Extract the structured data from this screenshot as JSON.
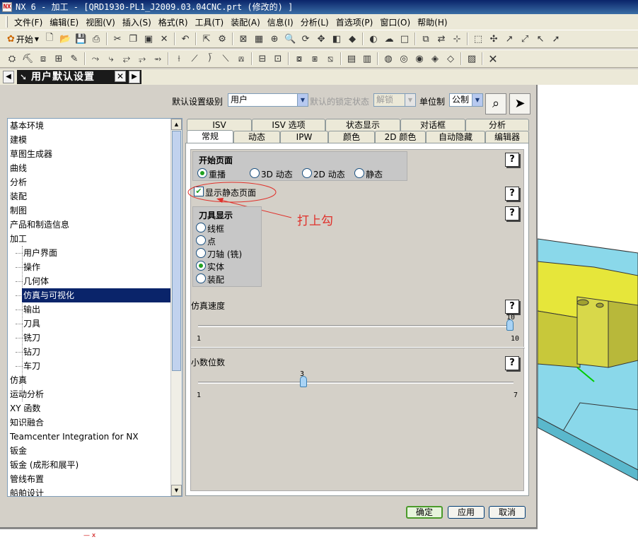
{
  "window": {
    "title": "NX 6 - 加工 - [QRD1930-PL1_J2009.03.04CNC.prt (修改的) ]"
  },
  "menu": [
    "文件(F)",
    "编辑(E)",
    "视图(V)",
    "插入(S)",
    "格式(R)",
    "工具(T)",
    "装配(A)",
    "信息(I)",
    "分析(L)",
    "首选项(P)",
    "窗口(O)",
    "帮助(H)"
  ],
  "toolbar": {
    "start_label": "开始"
  },
  "resource_bar": {
    "title": "用户默认设置"
  },
  "dialog": {
    "level_label": "默认设置级别",
    "level_value": "用户",
    "lock_label": "默认的锁定状态",
    "lock_value": "解锁",
    "unit_label": "单位制",
    "unit_value": "公制",
    "ok": "确定",
    "apply": "应用",
    "cancel": "取消"
  },
  "tree": [
    "基本环境",
    "建模",
    "草图生成器",
    "曲线",
    "分析",
    "装配",
    "制图",
    "产品和制造信息",
    "加工",
    "用户界面",
    "操作",
    "几何体",
    "仿真与可视化",
    "输出",
    "刀具",
    "铣刀",
    "钻刀",
    "车刀",
    "仿真",
    "运动分析",
    "XY 函数",
    "知识融合",
    "Teamcenter Integration for NX",
    "钣金",
    "钣金 (成形和展平)",
    "管线布置",
    "船舶设计"
  ],
  "tabs_row1": [
    "ISV",
    "ISV 选项",
    "状态显示",
    "对话框",
    "分析"
  ],
  "tabs_row2": [
    "常规",
    "动态",
    "IPW",
    "颜色",
    "2D 颜色",
    "自动隐藏",
    "编辑器"
  ],
  "start_page": {
    "title": "开始页面",
    "options": [
      "重播",
      "3D 动态",
      "2D 动态",
      "静态"
    ],
    "selected": "重播"
  },
  "show_static_page": {
    "label": "显示静态页面",
    "checked": true
  },
  "tool_display": {
    "title": "刀具显示",
    "options": [
      "线框",
      "点",
      "刀轴 (铣)",
      "实体",
      "装配"
    ],
    "selected": "实体"
  },
  "sim_speed": {
    "label": "仿真速度",
    "min": "1",
    "max": "10",
    "value": "10"
  },
  "decimals": {
    "label": "小数位数",
    "min": "1",
    "max": "7",
    "value": "3"
  },
  "annotation": "打上勾",
  "colors": {
    "selection": "#0a246a",
    "annotation": "#e0302a",
    "check": "#21a121"
  }
}
